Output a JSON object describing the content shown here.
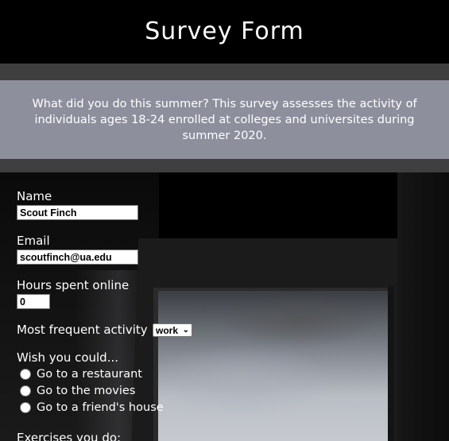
{
  "header": {
    "title": "Survey Form"
  },
  "description": "What did you do this summer? This survey assesses the activity of individuals ages 18-24 enrolled at colleges and universites during summer 2020.",
  "form": {
    "name": {
      "label": "Name",
      "value": "Scout Finch"
    },
    "email": {
      "label": "Email",
      "value": "scoutfinch@ua.edu"
    },
    "hours_online": {
      "label": "Hours spent online",
      "value": "0"
    },
    "frequent_activity": {
      "label": "Most frequent activity",
      "selected": "work"
    },
    "wish": {
      "label": "Wish you could...",
      "options": [
        "Go to a restaurant",
        "Go to the movies",
        "Go to a friend's house"
      ]
    },
    "exercises": {
      "label": "Exercises you do:"
    }
  },
  "colors": {
    "header_bg": "#000000",
    "band_bg": "#3f3f3f",
    "description_bg": "#8e8f9c",
    "text": "#ffffff"
  }
}
